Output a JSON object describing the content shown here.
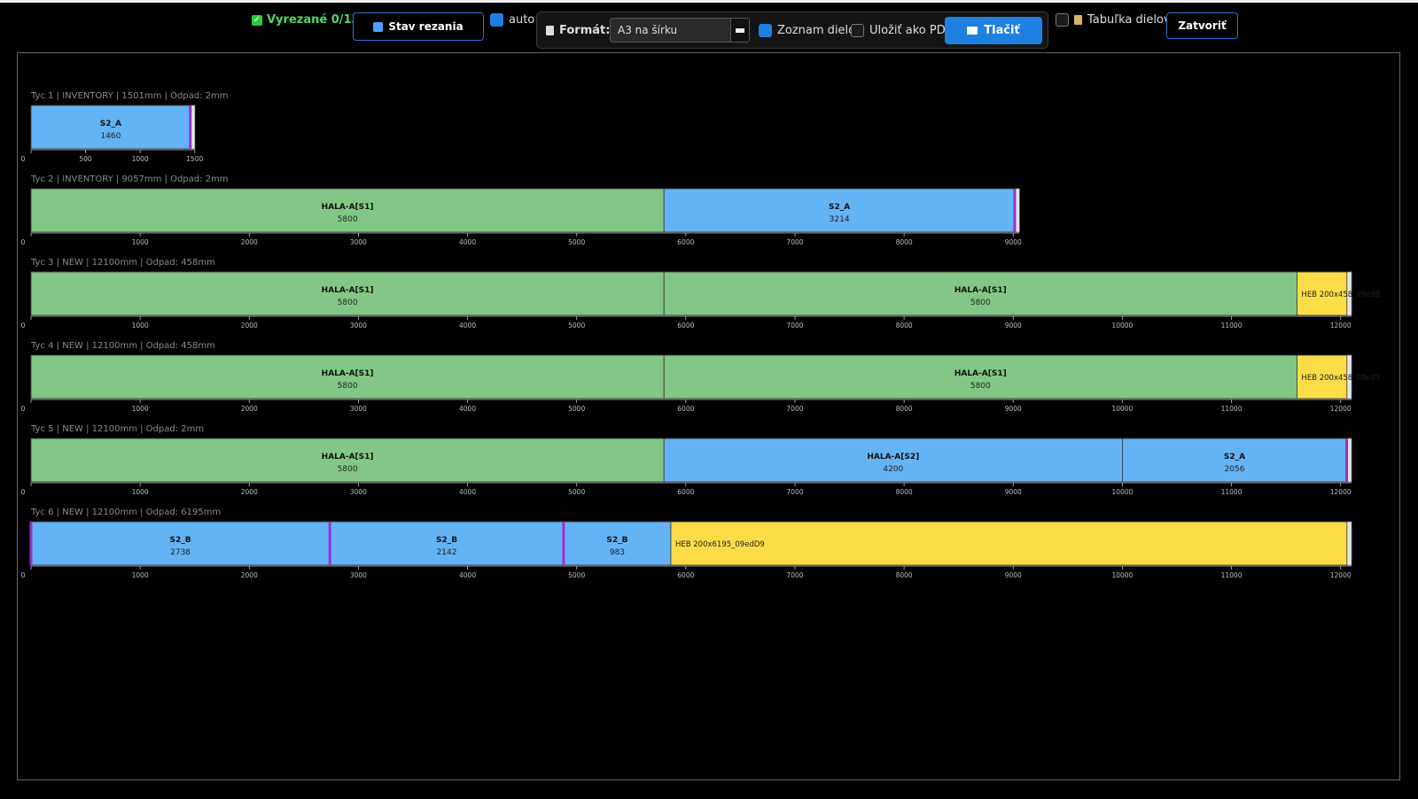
{
  "toolbar": {
    "cut_status": "Vyrezané 0/13",
    "stav_label": "Stav rezania",
    "auto_label": "auto",
    "format_label": "Formát:",
    "format_value": "A3 na šírku",
    "zoznam_label": "Zoznam dielov",
    "ulozit_label": "Uložiť ako PDF",
    "print_label": "Tlačiť",
    "tabulka_label": "Tabuľka dielov",
    "close_label": "Zatvoriť"
  },
  "checkboxes": {
    "auto": true,
    "zoznam": true,
    "ulozit": false,
    "tabulka": false
  },
  "colors": {
    "green": "#82c785",
    "blue": "#63b3f5",
    "yellow": "#fcdd48",
    "cut": "#9b30d0",
    "axis": "#bbbbbb",
    "accent": "#1e7fe0"
  },
  "bars": [
    {
      "header": "Tyc 1 | INVENTORY | 1501mm | Odpad: 2mm",
      "length": 1501,
      "ticks": [
        0,
        500,
        1000,
        1500
      ],
      "segments": [
        {
          "name": "S2_A",
          "len": 1460,
          "start": 0,
          "color": "blue"
        }
      ],
      "cuts": [
        1460
      ],
      "waste": null
    },
    {
      "header": "Tyc 2 | INVENTORY | 9057mm | Odpad: 2mm",
      "length": 9057,
      "ticks": [
        0,
        1000,
        2000,
        3000,
        4000,
        5000,
        6000,
        7000,
        8000,
        9000
      ],
      "segments": [
        {
          "name": "HALA-A[S1]",
          "len": 5800,
          "start": 0,
          "color": "green"
        },
        {
          "name": "S2_A",
          "len": 3214,
          "start": 5800,
          "color": "blue"
        }
      ],
      "cuts": [
        9014
      ],
      "waste": null
    },
    {
      "header": "Tyc 3 | NEW | 12100mm | Odpad: 458mm",
      "length": 12100,
      "ticks": [
        0,
        1000,
        2000,
        3000,
        4000,
        5000,
        6000,
        7000,
        8000,
        9000,
        10000,
        11000,
        12000
      ],
      "segments": [
        {
          "name": "HALA-A[S1]",
          "len": 5800,
          "start": 0,
          "color": "green"
        },
        {
          "name": "HALA-A[S1]",
          "len": 5800,
          "start": 5800,
          "color": "green"
        }
      ],
      "cuts": [],
      "waste": {
        "label": "HEB 200x458_09ed8",
        "start": 11600,
        "len": 458
      }
    },
    {
      "header": "Tyc 4 | NEW | 12100mm | Odpad: 458mm",
      "length": 12100,
      "ticks": [
        0,
        1000,
        2000,
        3000,
        4000,
        5000,
        6000,
        7000,
        8000,
        9000,
        10000,
        11000,
        12000
      ],
      "segments": [
        {
          "name": "HALA-A[S1]",
          "len": 5800,
          "start": 0,
          "color": "green"
        },
        {
          "name": "HALA-A[S1]",
          "len": 5800,
          "start": 5800,
          "color": "green"
        }
      ],
      "cuts": [],
      "waste": {
        "label": "HEB 200x458_09ed3",
        "start": 11600,
        "len": 458
      }
    },
    {
      "header": "Tyc 5 | NEW | 12100mm | Odpad: 2mm",
      "length": 12100,
      "ticks": [
        0,
        1000,
        2000,
        3000,
        4000,
        5000,
        6000,
        7000,
        8000,
        9000,
        10000,
        11000,
        12000
      ],
      "segments": [
        {
          "name": "HALA-A[S1]",
          "len": 5800,
          "start": 0,
          "color": "green"
        },
        {
          "name": "HALA-A[S2]",
          "len": 4200,
          "start": 5800,
          "color": "blue"
        },
        {
          "name": "S2_A",
          "len": 2056,
          "start": 10000,
          "color": "blue"
        }
      ],
      "cuts": [
        12056
      ],
      "waste": null
    },
    {
      "header": "Tyc 6 | NEW | 12100mm | Odpad: 6195mm",
      "length": 12100,
      "ticks": [
        0,
        1000,
        2000,
        3000,
        4000,
        5000,
        6000,
        7000,
        8000,
        9000,
        10000,
        11000,
        12000
      ],
      "segments": [
        {
          "name": "S2_B",
          "len": 2738,
          "start": 0,
          "color": "blue"
        },
        {
          "name": "S2_B",
          "len": 2142,
          "start": 2738,
          "color": "blue"
        },
        {
          "name": "S2_B",
          "len": 983,
          "start": 4880,
          "color": "blue"
        }
      ],
      "cuts": [
        0,
        2738,
        4880
      ],
      "waste": {
        "label": "HEB 200x6195_09edD9",
        "start": 5863,
        "len": 6195
      }
    }
  ]
}
